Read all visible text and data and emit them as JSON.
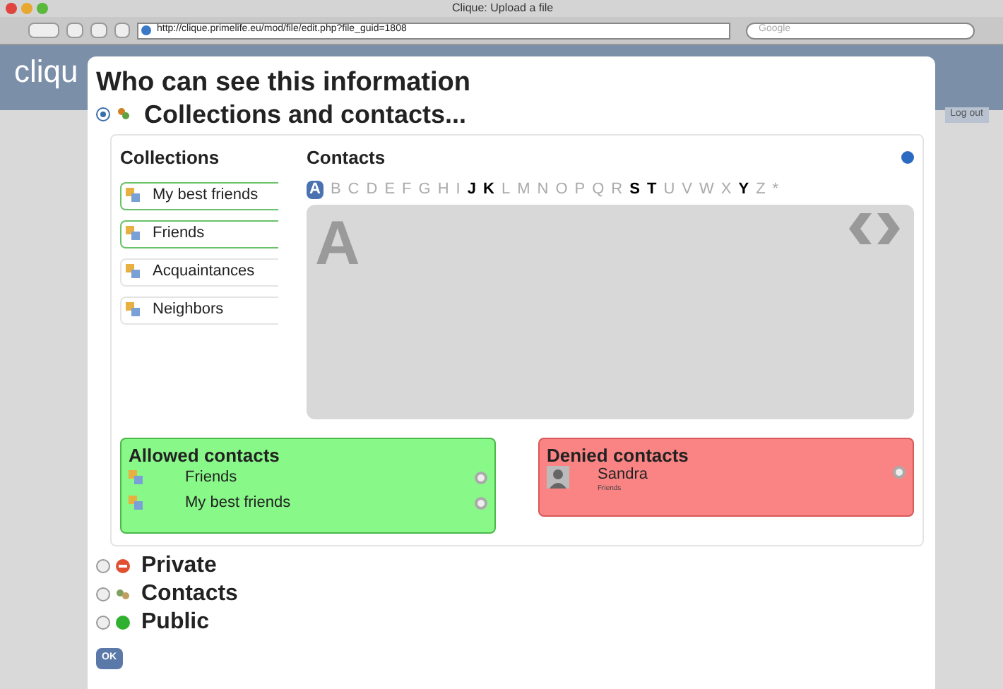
{
  "window": {
    "title": "Clique: Upload a file"
  },
  "toolbar": {
    "address": "http://clique.primelife.eu/mod/file/edit.php?file_guid=1808",
    "search_placeholder": "Google"
  },
  "page": {
    "logo": "cliqu",
    "logout": "Log out"
  },
  "dialog": {
    "title": "Who can see this information",
    "options": [
      {
        "label": "Collections and contacts...",
        "selected": true,
        "kind": "collections"
      },
      {
        "label": "Private",
        "selected": false,
        "kind": "private"
      },
      {
        "label": "Contacts",
        "selected": false,
        "kind": "contacts"
      },
      {
        "label": "Public",
        "selected": false,
        "kind": "public"
      }
    ],
    "collections": {
      "heading": "Collections",
      "items": [
        {
          "label": "My best friends",
          "selected": true
        },
        {
          "label": "Friends",
          "selected": true
        },
        {
          "label": "Acquaintances",
          "selected": false
        },
        {
          "label": "Neighbors",
          "selected": false
        }
      ]
    },
    "contacts": {
      "heading": "Contacts",
      "big_letter": "A",
      "letters": [
        {
          "label": "A",
          "selected": true,
          "available": true
        },
        {
          "label": "B",
          "selected": false,
          "available": false
        },
        {
          "label": "C",
          "selected": false,
          "available": false
        },
        {
          "label": "D",
          "selected": false,
          "available": false
        },
        {
          "label": "E",
          "selected": false,
          "available": false
        },
        {
          "label": "F",
          "selected": false,
          "available": false
        },
        {
          "label": "G",
          "selected": false,
          "available": false
        },
        {
          "label": "H",
          "selected": false,
          "available": false
        },
        {
          "label": "I",
          "selected": false,
          "available": false
        },
        {
          "label": "J",
          "selected": false,
          "available": true
        },
        {
          "label": "K",
          "selected": false,
          "available": true
        },
        {
          "label": "L",
          "selected": false,
          "available": false
        },
        {
          "label": "M",
          "selected": false,
          "available": false
        },
        {
          "label": "N",
          "selected": false,
          "available": false
        },
        {
          "label": "O",
          "selected": false,
          "available": false
        },
        {
          "label": "P",
          "selected": false,
          "available": false
        },
        {
          "label": "Q",
          "selected": false,
          "available": false
        },
        {
          "label": "R",
          "selected": false,
          "available": false
        },
        {
          "label": "S",
          "selected": false,
          "available": true
        },
        {
          "label": "T",
          "selected": false,
          "available": true
        },
        {
          "label": "U",
          "selected": false,
          "available": false
        },
        {
          "label": "V",
          "selected": false,
          "available": false
        },
        {
          "label": "W",
          "selected": false,
          "available": false
        },
        {
          "label": "X",
          "selected": false,
          "available": false
        },
        {
          "label": "Y",
          "selected": false,
          "available": true
        },
        {
          "label": "Z",
          "selected": false,
          "available": false
        },
        {
          "label": "*",
          "selected": false,
          "available": false
        }
      ]
    },
    "allowed": {
      "heading": "Allowed contacts",
      "items": [
        {
          "label": "Friends",
          "kind": "collection"
        },
        {
          "label": "My best friends",
          "kind": "collection"
        }
      ]
    },
    "denied": {
      "heading": "Denied contacts",
      "items": [
        {
          "label": "Sandra",
          "sub": "Friends",
          "kind": "person"
        }
      ]
    },
    "ok_button": "OK"
  }
}
